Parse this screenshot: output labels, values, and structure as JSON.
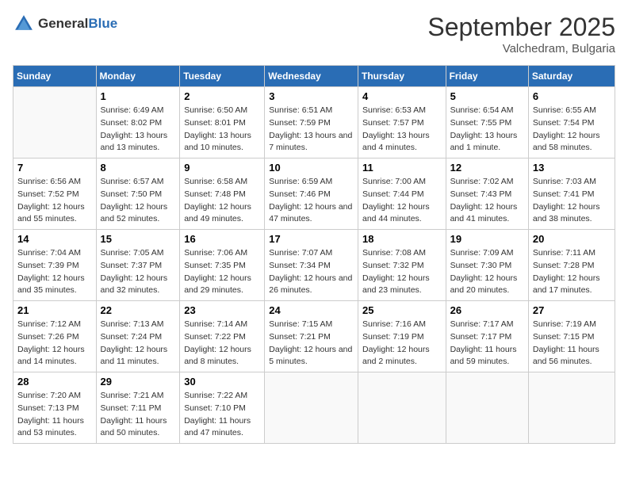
{
  "header": {
    "logo": {
      "general": "General",
      "blue": "Blue"
    },
    "month": "September 2025",
    "location": "Valchedram, Bulgaria"
  },
  "weekdays": [
    "Sunday",
    "Monday",
    "Tuesday",
    "Wednesday",
    "Thursday",
    "Friday",
    "Saturday"
  ],
  "weeks": [
    [
      {
        "day": "",
        "sunrise": "",
        "sunset": "",
        "daylight": ""
      },
      {
        "day": "1",
        "sunrise": "Sunrise: 6:49 AM",
        "sunset": "Sunset: 8:02 PM",
        "daylight": "Daylight: 13 hours and 13 minutes."
      },
      {
        "day": "2",
        "sunrise": "Sunrise: 6:50 AM",
        "sunset": "Sunset: 8:01 PM",
        "daylight": "Daylight: 13 hours and 10 minutes."
      },
      {
        "day": "3",
        "sunrise": "Sunrise: 6:51 AM",
        "sunset": "Sunset: 7:59 PM",
        "daylight": "Daylight: 13 hours and 7 minutes."
      },
      {
        "day": "4",
        "sunrise": "Sunrise: 6:53 AM",
        "sunset": "Sunset: 7:57 PM",
        "daylight": "Daylight: 13 hours and 4 minutes."
      },
      {
        "day": "5",
        "sunrise": "Sunrise: 6:54 AM",
        "sunset": "Sunset: 7:55 PM",
        "daylight": "Daylight: 13 hours and 1 minute."
      },
      {
        "day": "6",
        "sunrise": "Sunrise: 6:55 AM",
        "sunset": "Sunset: 7:54 PM",
        "daylight": "Daylight: 12 hours and 58 minutes."
      }
    ],
    [
      {
        "day": "7",
        "sunrise": "Sunrise: 6:56 AM",
        "sunset": "Sunset: 7:52 PM",
        "daylight": "Daylight: 12 hours and 55 minutes."
      },
      {
        "day": "8",
        "sunrise": "Sunrise: 6:57 AM",
        "sunset": "Sunset: 7:50 PM",
        "daylight": "Daylight: 12 hours and 52 minutes."
      },
      {
        "day": "9",
        "sunrise": "Sunrise: 6:58 AM",
        "sunset": "Sunset: 7:48 PM",
        "daylight": "Daylight: 12 hours and 49 minutes."
      },
      {
        "day": "10",
        "sunrise": "Sunrise: 6:59 AM",
        "sunset": "Sunset: 7:46 PM",
        "daylight": "Daylight: 12 hours and 47 minutes."
      },
      {
        "day": "11",
        "sunrise": "Sunrise: 7:00 AM",
        "sunset": "Sunset: 7:44 PM",
        "daylight": "Daylight: 12 hours and 44 minutes."
      },
      {
        "day": "12",
        "sunrise": "Sunrise: 7:02 AM",
        "sunset": "Sunset: 7:43 PM",
        "daylight": "Daylight: 12 hours and 41 minutes."
      },
      {
        "day": "13",
        "sunrise": "Sunrise: 7:03 AM",
        "sunset": "Sunset: 7:41 PM",
        "daylight": "Daylight: 12 hours and 38 minutes."
      }
    ],
    [
      {
        "day": "14",
        "sunrise": "Sunrise: 7:04 AM",
        "sunset": "Sunset: 7:39 PM",
        "daylight": "Daylight: 12 hours and 35 minutes."
      },
      {
        "day": "15",
        "sunrise": "Sunrise: 7:05 AM",
        "sunset": "Sunset: 7:37 PM",
        "daylight": "Daylight: 12 hours and 32 minutes."
      },
      {
        "day": "16",
        "sunrise": "Sunrise: 7:06 AM",
        "sunset": "Sunset: 7:35 PM",
        "daylight": "Daylight: 12 hours and 29 minutes."
      },
      {
        "day": "17",
        "sunrise": "Sunrise: 7:07 AM",
        "sunset": "Sunset: 7:34 PM",
        "daylight": "Daylight: 12 hours and 26 minutes."
      },
      {
        "day": "18",
        "sunrise": "Sunrise: 7:08 AM",
        "sunset": "Sunset: 7:32 PM",
        "daylight": "Daylight: 12 hours and 23 minutes."
      },
      {
        "day": "19",
        "sunrise": "Sunrise: 7:09 AM",
        "sunset": "Sunset: 7:30 PM",
        "daylight": "Daylight: 12 hours and 20 minutes."
      },
      {
        "day": "20",
        "sunrise": "Sunrise: 7:11 AM",
        "sunset": "Sunset: 7:28 PM",
        "daylight": "Daylight: 12 hours and 17 minutes."
      }
    ],
    [
      {
        "day": "21",
        "sunrise": "Sunrise: 7:12 AM",
        "sunset": "Sunset: 7:26 PM",
        "daylight": "Daylight: 12 hours and 14 minutes."
      },
      {
        "day": "22",
        "sunrise": "Sunrise: 7:13 AM",
        "sunset": "Sunset: 7:24 PM",
        "daylight": "Daylight: 12 hours and 11 minutes."
      },
      {
        "day": "23",
        "sunrise": "Sunrise: 7:14 AM",
        "sunset": "Sunset: 7:22 PM",
        "daylight": "Daylight: 12 hours and 8 minutes."
      },
      {
        "day": "24",
        "sunrise": "Sunrise: 7:15 AM",
        "sunset": "Sunset: 7:21 PM",
        "daylight": "Daylight: 12 hours and 5 minutes."
      },
      {
        "day": "25",
        "sunrise": "Sunrise: 7:16 AM",
        "sunset": "Sunset: 7:19 PM",
        "daylight": "Daylight: 12 hours and 2 minutes."
      },
      {
        "day": "26",
        "sunrise": "Sunrise: 7:17 AM",
        "sunset": "Sunset: 7:17 PM",
        "daylight": "Daylight: 11 hours and 59 minutes."
      },
      {
        "day": "27",
        "sunrise": "Sunrise: 7:19 AM",
        "sunset": "Sunset: 7:15 PM",
        "daylight": "Daylight: 11 hours and 56 minutes."
      }
    ],
    [
      {
        "day": "28",
        "sunrise": "Sunrise: 7:20 AM",
        "sunset": "Sunset: 7:13 PM",
        "daylight": "Daylight: 11 hours and 53 minutes."
      },
      {
        "day": "29",
        "sunrise": "Sunrise: 7:21 AM",
        "sunset": "Sunset: 7:11 PM",
        "daylight": "Daylight: 11 hours and 50 minutes."
      },
      {
        "day": "30",
        "sunrise": "Sunrise: 7:22 AM",
        "sunset": "Sunset: 7:10 PM",
        "daylight": "Daylight: 11 hours and 47 minutes."
      },
      {
        "day": "",
        "sunrise": "",
        "sunset": "",
        "daylight": ""
      },
      {
        "day": "",
        "sunrise": "",
        "sunset": "",
        "daylight": ""
      },
      {
        "day": "",
        "sunrise": "",
        "sunset": "",
        "daylight": ""
      },
      {
        "day": "",
        "sunrise": "",
        "sunset": "",
        "daylight": ""
      }
    ]
  ]
}
